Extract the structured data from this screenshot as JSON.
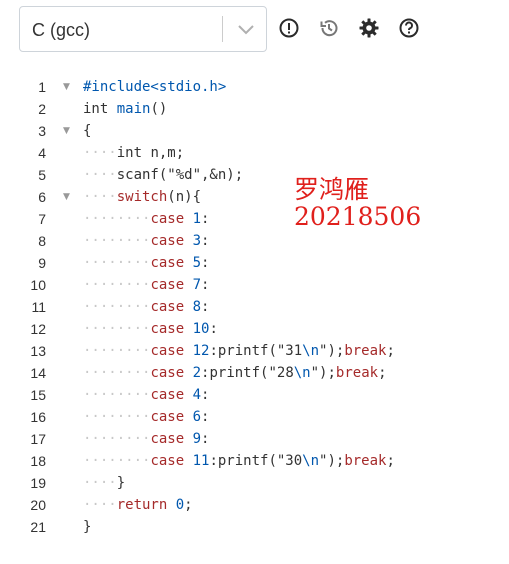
{
  "toolbar": {
    "language": "C (gcc)",
    "icons": [
      "info-icon",
      "history-icon",
      "gear-icon",
      "help-icon"
    ]
  },
  "editor": {
    "lines": [
      {
        "num": "1",
        "fold": true,
        "indent": 0,
        "tokens": [
          [
            "pp",
            "#include<stdio.h>"
          ]
        ]
      },
      {
        "num": "2",
        "fold": false,
        "indent": 0,
        "tokens": [
          [
            "t",
            "int "
          ],
          [
            "fn",
            "main"
          ],
          [
            "s",
            "()"
          ]
        ]
      },
      {
        "num": "3",
        "fold": true,
        "indent": 0,
        "tokens": [
          [
            "s",
            "{"
          ]
        ]
      },
      {
        "num": "4",
        "fold": false,
        "indent": 1,
        "tokens": [
          [
            "t",
            "int"
          ],
          [
            "s",
            " n,m;"
          ]
        ]
      },
      {
        "num": "5",
        "fold": false,
        "indent": 1,
        "tokens": [
          [
            "s",
            "scanf(\"%d\",&n);"
          ]
        ]
      },
      {
        "num": "6",
        "fold": true,
        "indent": 1,
        "tokens": [
          [
            "k",
            "switch"
          ],
          [
            "s",
            "(n){"
          ]
        ]
      },
      {
        "num": "7",
        "fold": false,
        "indent": 2,
        "tokens": [
          [
            "k",
            "case"
          ],
          [
            "s",
            " "
          ],
          [
            "n",
            "1"
          ],
          [
            "s",
            ":"
          ]
        ]
      },
      {
        "num": "8",
        "fold": false,
        "indent": 2,
        "tokens": [
          [
            "k",
            "case"
          ],
          [
            "s",
            " "
          ],
          [
            "n",
            "3"
          ],
          [
            "s",
            ":"
          ]
        ]
      },
      {
        "num": "9",
        "fold": false,
        "indent": 2,
        "tokens": [
          [
            "k",
            "case"
          ],
          [
            "s",
            " "
          ],
          [
            "n",
            "5"
          ],
          [
            "s",
            ":"
          ]
        ]
      },
      {
        "num": "10",
        "fold": false,
        "indent": 2,
        "tokens": [
          [
            "k",
            "case"
          ],
          [
            "s",
            " "
          ],
          [
            "n",
            "7"
          ],
          [
            "s",
            ":"
          ]
        ]
      },
      {
        "num": "11",
        "fold": false,
        "indent": 2,
        "tokens": [
          [
            "k",
            "case"
          ],
          [
            "s",
            " "
          ],
          [
            "n",
            "8"
          ],
          [
            "s",
            ":"
          ]
        ]
      },
      {
        "num": "12",
        "fold": false,
        "indent": 2,
        "tokens": [
          [
            "k",
            "case"
          ],
          [
            "s",
            " "
          ],
          [
            "n",
            "10"
          ],
          [
            "s",
            ":"
          ]
        ]
      },
      {
        "num": "13",
        "fold": false,
        "indent": 2,
        "tokens": [
          [
            "k",
            "case"
          ],
          [
            "s",
            " "
          ],
          [
            "n",
            "12"
          ],
          [
            "s",
            ":printf(\"31"
          ],
          [
            "n",
            "\\n"
          ],
          [
            "s",
            "\");"
          ],
          [
            "k",
            "break"
          ],
          [
            "s",
            ";"
          ]
        ]
      },
      {
        "num": "14",
        "fold": false,
        "indent": 2,
        "tokens": [
          [
            "k",
            "case"
          ],
          [
            "s",
            " "
          ],
          [
            "n",
            "2"
          ],
          [
            "s",
            ":printf(\"28"
          ],
          [
            "n",
            "\\n"
          ],
          [
            "s",
            "\");"
          ],
          [
            "k",
            "break"
          ],
          [
            "s",
            ";"
          ]
        ]
      },
      {
        "num": "15",
        "fold": false,
        "indent": 2,
        "tokens": [
          [
            "k",
            "case"
          ],
          [
            "s",
            " "
          ],
          [
            "n",
            "4"
          ],
          [
            "s",
            ":"
          ]
        ]
      },
      {
        "num": "16",
        "fold": false,
        "indent": 2,
        "tokens": [
          [
            "k",
            "case"
          ],
          [
            "s",
            " "
          ],
          [
            "n",
            "6"
          ],
          [
            "s",
            ":"
          ]
        ]
      },
      {
        "num": "17",
        "fold": false,
        "indent": 2,
        "tokens": [
          [
            "k",
            "case"
          ],
          [
            "s",
            " "
          ],
          [
            "n",
            "9"
          ],
          [
            "s",
            ":"
          ]
        ]
      },
      {
        "num": "18",
        "fold": false,
        "indent": 2,
        "tokens": [
          [
            "k",
            "case"
          ],
          [
            "s",
            " "
          ],
          [
            "n",
            "11"
          ],
          [
            "s",
            ":printf(\"30"
          ],
          [
            "n",
            "\\n"
          ],
          [
            "s",
            "\");"
          ],
          [
            "k",
            "break"
          ],
          [
            "s",
            ";"
          ]
        ]
      },
      {
        "num": "19",
        "fold": false,
        "indent": 1,
        "tokens": [
          [
            "s",
            "}"
          ]
        ]
      },
      {
        "num": "20",
        "fold": false,
        "indent": 1,
        "tokens": [
          [
            "k",
            "return"
          ],
          [
            "s",
            " "
          ],
          [
            "n",
            "0"
          ],
          [
            "s",
            ";"
          ]
        ]
      },
      {
        "num": "21",
        "fold": false,
        "indent": 0,
        "tokens": [
          [
            "s",
            "}"
          ]
        ]
      }
    ]
  },
  "annotation": {
    "name": "罗鸿雁",
    "id": "20218506",
    "color": "#e0201c"
  }
}
